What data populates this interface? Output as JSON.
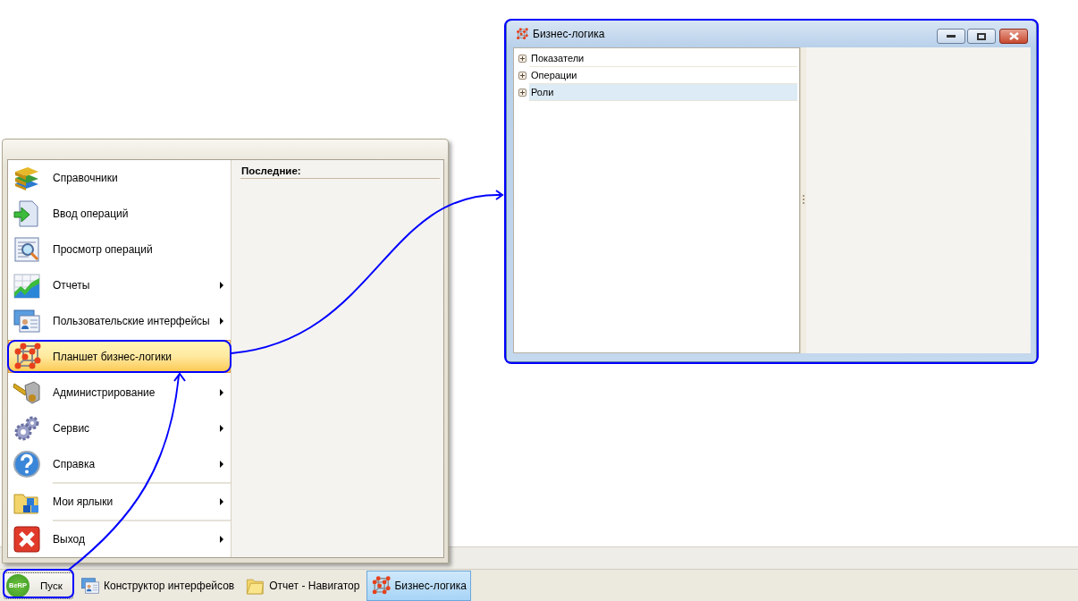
{
  "app_window": {
    "title": "Бизнес-логика",
    "tree": [
      {
        "label": "Показатели",
        "expanded": false,
        "selected": false
      },
      {
        "label": "Операции",
        "expanded": false,
        "selected": false
      },
      {
        "label": "Роли",
        "expanded": false,
        "selected": true
      }
    ]
  },
  "start_menu": {
    "items": [
      {
        "label": "Справочники",
        "submenu": false,
        "selected": false,
        "divider_above": false
      },
      {
        "label": "Ввод операций",
        "submenu": false,
        "selected": false,
        "divider_above": false
      },
      {
        "label": "Просмотр операций",
        "submenu": false,
        "selected": false,
        "divider_above": false
      },
      {
        "label": "Отчеты",
        "submenu": true,
        "selected": false,
        "divider_above": false
      },
      {
        "label": "Пользовательские интерфейсы",
        "submenu": true,
        "selected": false,
        "divider_above": false
      },
      {
        "label": "Планшет бизнес-логики",
        "submenu": false,
        "selected": true,
        "divider_above": false
      },
      {
        "label": "Администрирование",
        "submenu": true,
        "selected": false,
        "divider_above": false
      },
      {
        "label": "Сервис",
        "submenu": true,
        "selected": false,
        "divider_above": false
      },
      {
        "label": "Справка",
        "submenu": true,
        "selected": false,
        "divider_above": false
      },
      {
        "label": "Мои ярлыки",
        "submenu": true,
        "selected": false,
        "divider_above": true
      },
      {
        "label": "Выход",
        "submenu": true,
        "selected": false,
        "divider_above": true
      }
    ],
    "recent_heading": "Последние:"
  },
  "taskbar": {
    "start_logo": "BeRP",
    "start_label": "Пуск",
    "tasks": [
      {
        "label": "Конструктор интерфейсов",
        "selected": false
      },
      {
        "label": "Отчет - Навигатор",
        "selected": false
      },
      {
        "label": "Бизнес-логика",
        "selected": true
      }
    ]
  }
}
